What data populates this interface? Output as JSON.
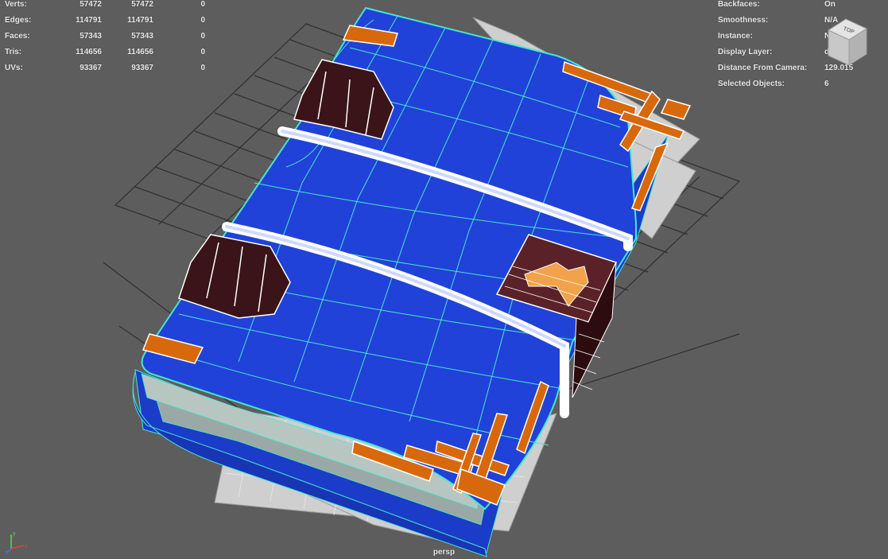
{
  "stats": {
    "rows": [
      {
        "label": "Verts:",
        "v1": "57472",
        "v2": "57472",
        "v3": "0"
      },
      {
        "label": "Edges:",
        "v1": "114791",
        "v2": "114791",
        "v3": "0"
      },
      {
        "label": "Faces:",
        "v1": "57343",
        "v2": "57343",
        "v3": "0"
      },
      {
        "label": "Tris:",
        "v1": "114656",
        "v2": "114656",
        "v3": "0"
      },
      {
        "label": "UVs:",
        "v1": "93367",
        "v2": "93367",
        "v3": "0"
      }
    ]
  },
  "info": {
    "rows": [
      {
        "label": "Backfaces:",
        "value": "On"
      },
      {
        "label": "Smoothness:",
        "value": "N/A"
      },
      {
        "label": "Instance:",
        "value": "No"
      },
      {
        "label": "Display Layer:",
        "value": "default"
      },
      {
        "label": "Distance From Camera:",
        "value": "129.015"
      },
      {
        "label": "Selected Objects:",
        "value": "6"
      }
    ]
  },
  "camera": {
    "label": "persp"
  },
  "viewcube": {
    "face_label": "TOP"
  },
  "axis": {
    "x": "x",
    "y": "y",
    "z": "z"
  },
  "colors": {
    "background": "#5d5d5d",
    "grid": "#2e2e2e",
    "cover": "#2140d6",
    "wire": "#46e6d2",
    "leather": "#3a1418",
    "brass": "#d8680c",
    "paper": "#d2d2d2",
    "strap": "#ffffff"
  }
}
